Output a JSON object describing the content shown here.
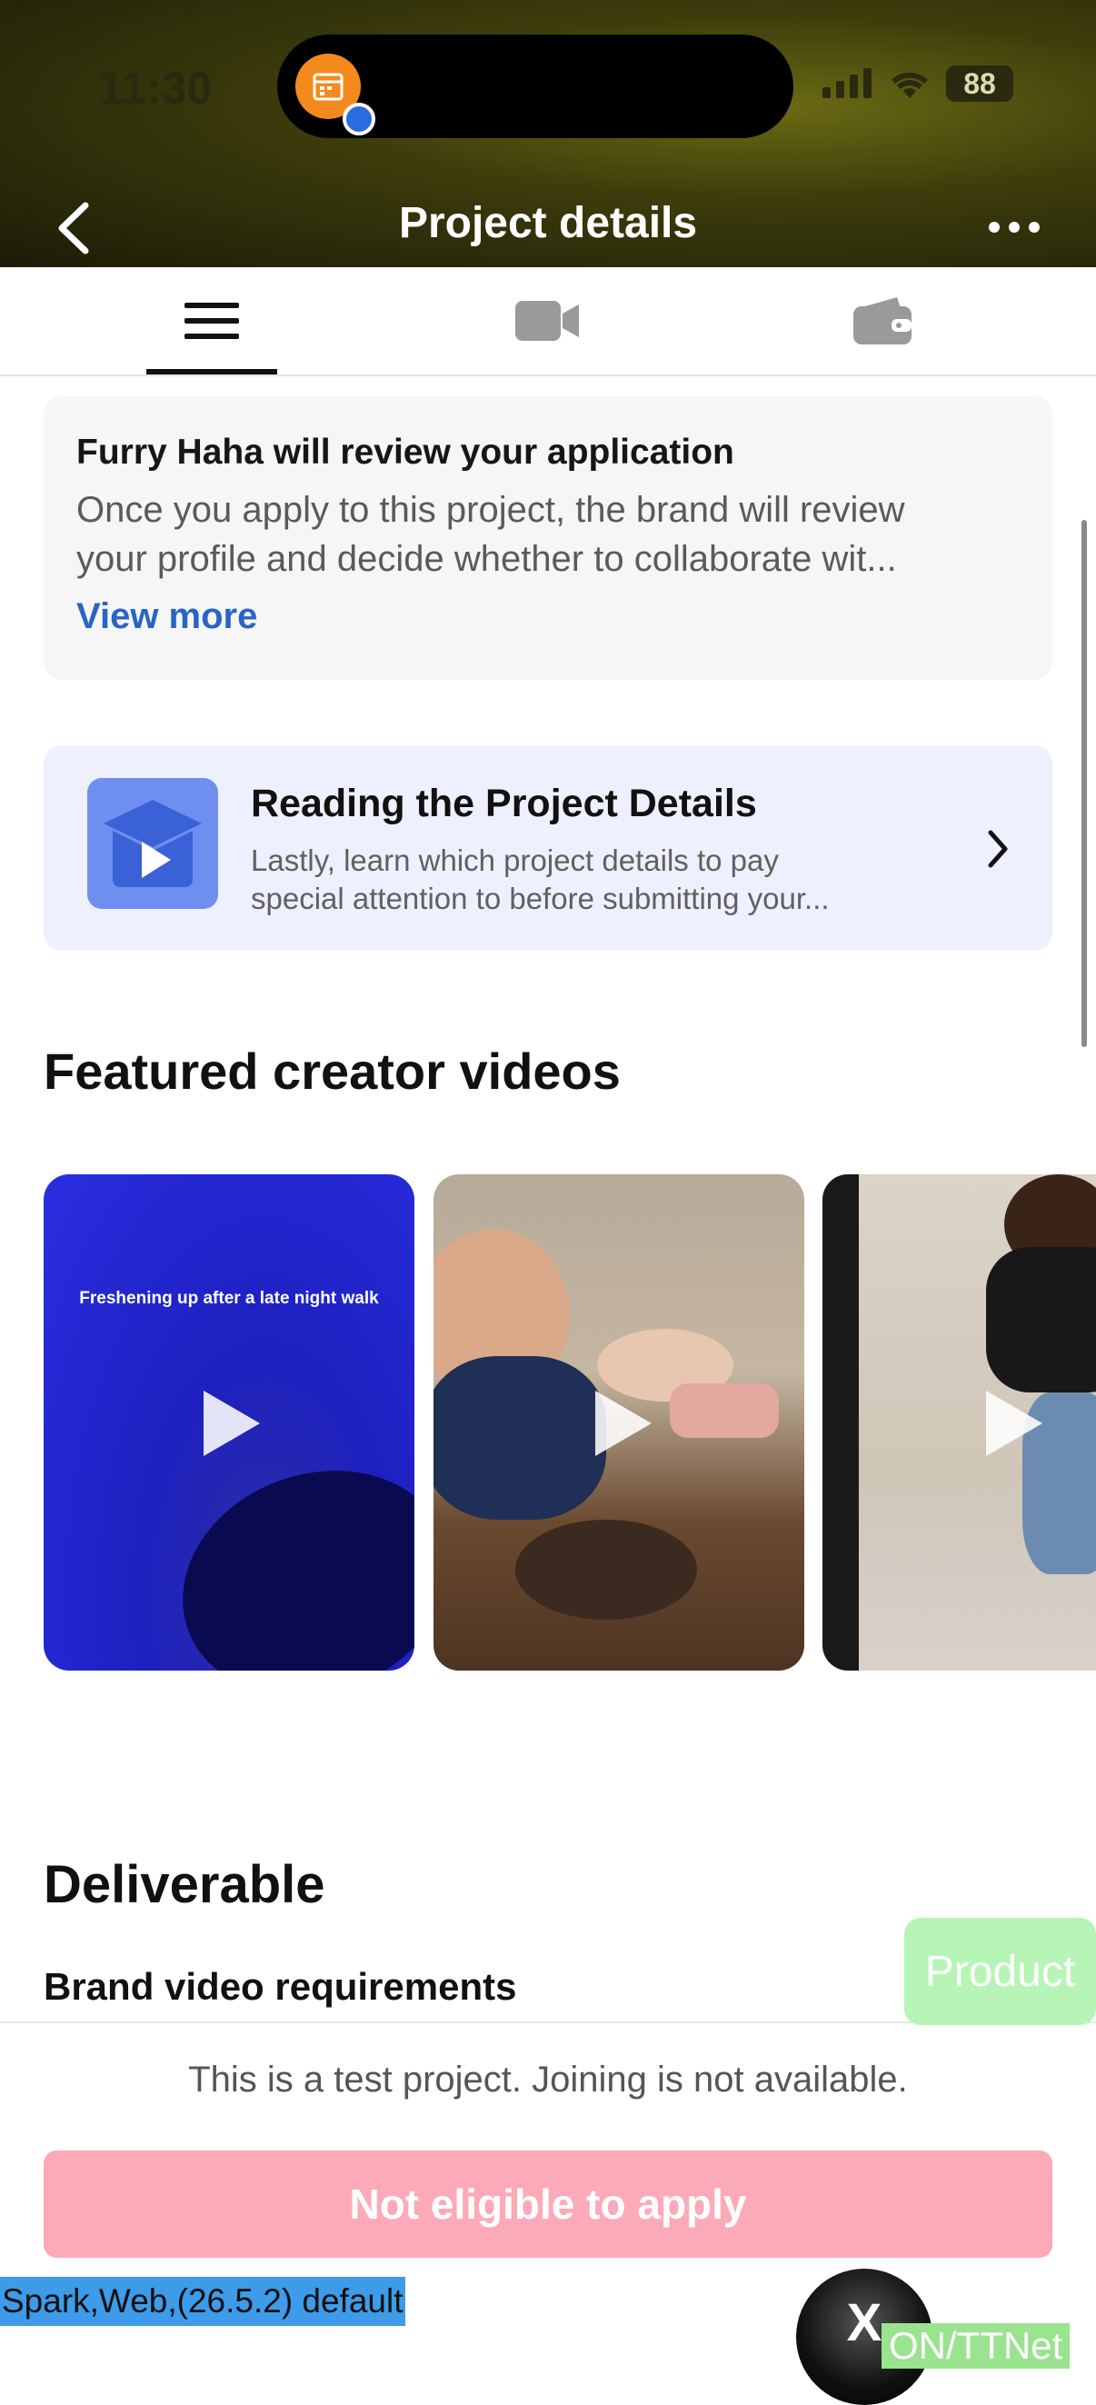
{
  "status_bar": {
    "time": "11:30",
    "battery": "88"
  },
  "header": {
    "title": "Project details"
  },
  "tabs": [
    {
      "icon": "menu-icon",
      "active": true
    },
    {
      "icon": "video-camera-icon",
      "active": false
    },
    {
      "icon": "wallet-icon",
      "active": false
    }
  ],
  "review_card": {
    "title": "Furry Haha will review your application",
    "body_line1": "Once you apply to this project, the brand will review",
    "body_line2": "your profile and decide whether to collaborate wit...",
    "link": "View more"
  },
  "learn_card": {
    "title": "Reading the Project Details",
    "desc_line1": "Lastly, learn which project details to pay",
    "desc_line2": "special attention to before submitting your..."
  },
  "featured": {
    "heading": "Featured creator videos",
    "videos": [
      {
        "caption": "Freshening up after a late night walk"
      },
      {
        "caption": ""
      },
      {
        "caption": ""
      }
    ]
  },
  "deliverable": {
    "heading": "Deliverable",
    "subheading": "Brand video requirements"
  },
  "floating": {
    "product": "Product",
    "x_label": "X",
    "net_tag": "ON/TTNet"
  },
  "bottom": {
    "note": "This is a test project. Joining is not available.",
    "apply_label": "Not eligible to apply"
  },
  "debug_label": "Spark,Web,(26.5.2) default",
  "colors": {
    "accent_link": "#2a64c4",
    "apply_disabled": "#fdaab8",
    "learn_bg": "#eef0ff"
  }
}
